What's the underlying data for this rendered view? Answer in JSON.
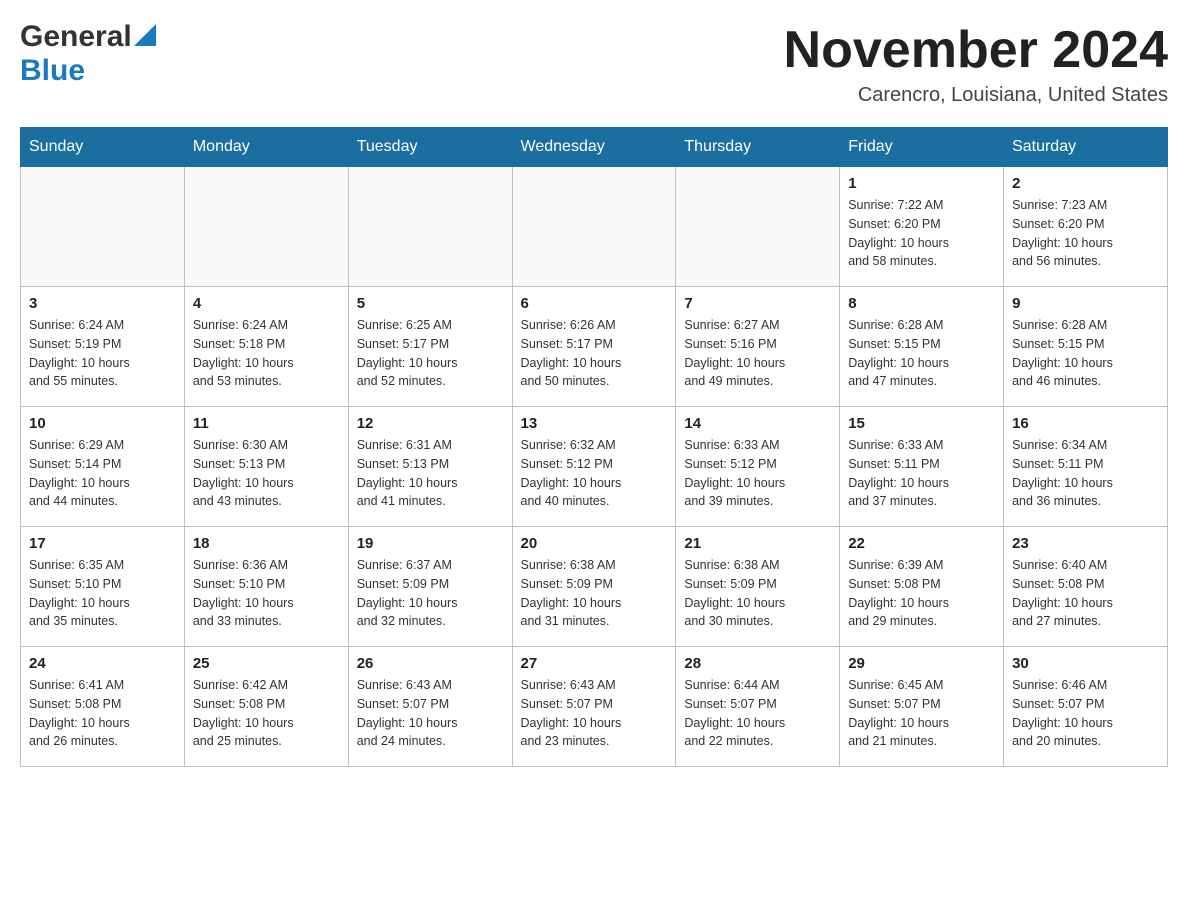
{
  "logo": {
    "general": "General",
    "blue": "Blue"
  },
  "title": {
    "month_year": "November 2024",
    "location": "Carencro, Louisiana, United States"
  },
  "days_of_week": [
    "Sunday",
    "Monday",
    "Tuesday",
    "Wednesday",
    "Thursday",
    "Friday",
    "Saturday"
  ],
  "weeks": [
    [
      {
        "day": "",
        "info": ""
      },
      {
        "day": "",
        "info": ""
      },
      {
        "day": "",
        "info": ""
      },
      {
        "day": "",
        "info": ""
      },
      {
        "day": "",
        "info": ""
      },
      {
        "day": "1",
        "info": "Sunrise: 7:22 AM\nSunset: 6:20 PM\nDaylight: 10 hours\nand 58 minutes."
      },
      {
        "day": "2",
        "info": "Sunrise: 7:23 AM\nSunset: 6:20 PM\nDaylight: 10 hours\nand 56 minutes."
      }
    ],
    [
      {
        "day": "3",
        "info": "Sunrise: 6:24 AM\nSunset: 5:19 PM\nDaylight: 10 hours\nand 55 minutes."
      },
      {
        "day": "4",
        "info": "Sunrise: 6:24 AM\nSunset: 5:18 PM\nDaylight: 10 hours\nand 53 minutes."
      },
      {
        "day": "5",
        "info": "Sunrise: 6:25 AM\nSunset: 5:17 PM\nDaylight: 10 hours\nand 52 minutes."
      },
      {
        "day": "6",
        "info": "Sunrise: 6:26 AM\nSunset: 5:17 PM\nDaylight: 10 hours\nand 50 minutes."
      },
      {
        "day": "7",
        "info": "Sunrise: 6:27 AM\nSunset: 5:16 PM\nDaylight: 10 hours\nand 49 minutes."
      },
      {
        "day": "8",
        "info": "Sunrise: 6:28 AM\nSunset: 5:15 PM\nDaylight: 10 hours\nand 47 minutes."
      },
      {
        "day": "9",
        "info": "Sunrise: 6:28 AM\nSunset: 5:15 PM\nDaylight: 10 hours\nand 46 minutes."
      }
    ],
    [
      {
        "day": "10",
        "info": "Sunrise: 6:29 AM\nSunset: 5:14 PM\nDaylight: 10 hours\nand 44 minutes."
      },
      {
        "day": "11",
        "info": "Sunrise: 6:30 AM\nSunset: 5:13 PM\nDaylight: 10 hours\nand 43 minutes."
      },
      {
        "day": "12",
        "info": "Sunrise: 6:31 AM\nSunset: 5:13 PM\nDaylight: 10 hours\nand 41 minutes."
      },
      {
        "day": "13",
        "info": "Sunrise: 6:32 AM\nSunset: 5:12 PM\nDaylight: 10 hours\nand 40 minutes."
      },
      {
        "day": "14",
        "info": "Sunrise: 6:33 AM\nSunset: 5:12 PM\nDaylight: 10 hours\nand 39 minutes."
      },
      {
        "day": "15",
        "info": "Sunrise: 6:33 AM\nSunset: 5:11 PM\nDaylight: 10 hours\nand 37 minutes."
      },
      {
        "day": "16",
        "info": "Sunrise: 6:34 AM\nSunset: 5:11 PM\nDaylight: 10 hours\nand 36 minutes."
      }
    ],
    [
      {
        "day": "17",
        "info": "Sunrise: 6:35 AM\nSunset: 5:10 PM\nDaylight: 10 hours\nand 35 minutes."
      },
      {
        "day": "18",
        "info": "Sunrise: 6:36 AM\nSunset: 5:10 PM\nDaylight: 10 hours\nand 33 minutes."
      },
      {
        "day": "19",
        "info": "Sunrise: 6:37 AM\nSunset: 5:09 PM\nDaylight: 10 hours\nand 32 minutes."
      },
      {
        "day": "20",
        "info": "Sunrise: 6:38 AM\nSunset: 5:09 PM\nDaylight: 10 hours\nand 31 minutes."
      },
      {
        "day": "21",
        "info": "Sunrise: 6:38 AM\nSunset: 5:09 PM\nDaylight: 10 hours\nand 30 minutes."
      },
      {
        "day": "22",
        "info": "Sunrise: 6:39 AM\nSunset: 5:08 PM\nDaylight: 10 hours\nand 29 minutes."
      },
      {
        "day": "23",
        "info": "Sunrise: 6:40 AM\nSunset: 5:08 PM\nDaylight: 10 hours\nand 27 minutes."
      }
    ],
    [
      {
        "day": "24",
        "info": "Sunrise: 6:41 AM\nSunset: 5:08 PM\nDaylight: 10 hours\nand 26 minutes."
      },
      {
        "day": "25",
        "info": "Sunrise: 6:42 AM\nSunset: 5:08 PM\nDaylight: 10 hours\nand 25 minutes."
      },
      {
        "day": "26",
        "info": "Sunrise: 6:43 AM\nSunset: 5:07 PM\nDaylight: 10 hours\nand 24 minutes."
      },
      {
        "day": "27",
        "info": "Sunrise: 6:43 AM\nSunset: 5:07 PM\nDaylight: 10 hours\nand 23 minutes."
      },
      {
        "day": "28",
        "info": "Sunrise: 6:44 AM\nSunset: 5:07 PM\nDaylight: 10 hours\nand 22 minutes."
      },
      {
        "day": "29",
        "info": "Sunrise: 6:45 AM\nSunset: 5:07 PM\nDaylight: 10 hours\nand 21 minutes."
      },
      {
        "day": "30",
        "info": "Sunrise: 6:46 AM\nSunset: 5:07 PM\nDaylight: 10 hours\nand 20 minutes."
      }
    ]
  ]
}
